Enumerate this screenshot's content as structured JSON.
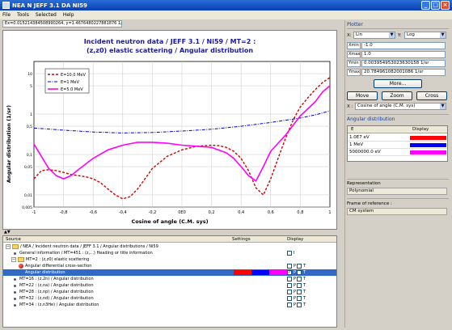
{
  "window": {
    "title": "NEA N JEFF 3.1 DA NI59",
    "controls": {
      "minimize": "_",
      "maximize": "□",
      "close": "×"
    }
  },
  "menu": [
    "File",
    "Tools",
    "Selected",
    "Help"
  ],
  "coord_readout": "Ex=0.015214384508990264, y=1.4676480227881876 1/sr)",
  "plot": {
    "title_line1": "Incident neutron data / JEFF 3.1 / Ni59 / MT=2 :",
    "title_line2": "(z,z0) elastic scattering / Angular distribution",
    "xlabel": "Cosine of angle (C.M. sys)",
    "ylabel": "Angular distribution (1/sr)"
  },
  "chart_data": {
    "type": "line",
    "xlim": [
      -1,
      1
    ],
    "ylim": [
      0.005,
      20
    ],
    "yscale": "log",
    "grid": true,
    "legend": "top-left",
    "x_ticks": [
      "-1",
      "-0,8",
      "-0,6",
      "-0,4",
      "-0,2",
      "0E0",
      "0,2",
      "0,4",
      "0,6",
      "0,8",
      "1"
    ],
    "y_ticks": [
      "0,005",
      "0,01",
      "0,05",
      "0,1",
      "0,5",
      "1",
      "5",
      "10"
    ],
    "series": [
      {
        "name": "E=10.0 MeV",
        "color": "#cc0000",
        "style": "dashed",
        "x": [
          -1.0,
          -0.95,
          -0.9,
          -0.85,
          -0.8,
          -0.75,
          -0.7,
          -0.65,
          -0.6,
          -0.55,
          -0.5,
          -0.45,
          -0.4,
          -0.35,
          -0.3,
          -0.25,
          -0.2,
          -0.1,
          0.0,
          0.1,
          0.2,
          0.25,
          0.3,
          0.35,
          0.4,
          0.45,
          0.5,
          0.55,
          0.6,
          0.65,
          0.7,
          0.75,
          0.8,
          0.85,
          0.9,
          0.95,
          1.0
        ],
        "y": [
          0.025,
          0.04,
          0.042,
          0.04,
          0.036,
          0.032,
          0.03,
          0.028,
          0.025,
          0.02,
          0.014,
          0.01,
          0.008,
          0.009,
          0.014,
          0.025,
          0.045,
          0.09,
          0.13,
          0.16,
          0.17,
          0.165,
          0.15,
          0.12,
          0.08,
          0.04,
          0.015,
          0.01,
          0.025,
          0.08,
          0.25,
          0.7,
          1.5,
          2.5,
          4.0,
          6.0,
          8.0
        ]
      },
      {
        "name": "E=1 MeV",
        "color": "#0000cc",
        "style": "dashdot",
        "x": [
          -1.0,
          -0.8,
          -0.6,
          -0.4,
          -0.2,
          0.0,
          0.2,
          0.4,
          0.6,
          0.8,
          0.9,
          1.0
        ],
        "y": [
          0.45,
          0.4,
          0.36,
          0.34,
          0.35,
          0.38,
          0.42,
          0.5,
          0.62,
          0.8,
          0.95,
          1.2
        ]
      },
      {
        "name": "E=5.0 MeV",
        "color": "#ff00ff",
        "style": "solid",
        "x": [
          -1.0,
          -0.95,
          -0.9,
          -0.85,
          -0.8,
          -0.75,
          -0.7,
          -0.65,
          -0.6,
          -0.5,
          -0.4,
          -0.3,
          -0.2,
          -0.1,
          0.0,
          0.1,
          0.2,
          0.3,
          0.35,
          0.4,
          0.45,
          0.5,
          0.55,
          0.6,
          0.7,
          0.8,
          0.9,
          0.95,
          1.0
        ],
        "y": [
          0.18,
          0.09,
          0.045,
          0.03,
          0.025,
          0.03,
          0.042,
          0.058,
          0.08,
          0.13,
          0.17,
          0.2,
          0.2,
          0.19,
          0.17,
          0.16,
          0.15,
          0.11,
          0.08,
          0.05,
          0.03,
          0.022,
          0.05,
          0.12,
          0.3,
          0.9,
          2.0,
          3.5,
          5.0
        ]
      }
    ]
  },
  "tree": {
    "headers": {
      "source": "Source",
      "settings": "Settings",
      "display": "Display"
    },
    "rows": [
      {
        "indent": 0,
        "icon": "folder",
        "label": "/ NEA / Incident neutron data / JEFF 3.1 / Angular distributions / Ni59",
        "checks": []
      },
      {
        "indent": 1,
        "icon": "bullet",
        "label": "General information / MT=451 : (z,...) Heading or title information",
        "checks": [
          "I"
        ]
      },
      {
        "indent": 1,
        "icon": "folder",
        "label": "MT=2 : (z,z0) elastic scattering",
        "checks": []
      },
      {
        "indent": 2,
        "icon": "redball",
        "label": "Angular differential cross-section",
        "checks": [
          "P",
          "T"
        ]
      },
      {
        "indent": 2,
        "icon": "none",
        "label": "Angular distribution",
        "checks": [
          "P",
          "T"
        ],
        "selected": true
      },
      {
        "indent": 1,
        "icon": "bullet",
        "label": "MT=16 : (z,2n) / Angular distribution",
        "checks": [
          "P",
          "T"
        ]
      },
      {
        "indent": 1,
        "icon": "bullet",
        "label": "MT=22 : (z,na) / Angular distribution",
        "checks": [
          "P",
          "T"
        ]
      },
      {
        "indent": 1,
        "icon": "bullet",
        "label": "MT=28 : (z,np) / Angular distribution",
        "checks": [
          "P",
          "T"
        ]
      },
      {
        "indent": 1,
        "icon": "bullet",
        "label": "MT=32 : (z,nd) / Angular distribution",
        "checks": [
          "P",
          "T"
        ]
      },
      {
        "indent": 1,
        "icon": "bullet",
        "label": "MT=34 : (z,n3He) / Angular distribution",
        "checks": [
          "P",
          "T"
        ]
      }
    ]
  },
  "plotter": {
    "section": "Plotter",
    "x_label": "X:",
    "x_scale": "Lin",
    "y_label": "Y:",
    "y_scale": "Log",
    "xmin_label": "Xmin",
    "xmin": "-1.0",
    "xmax_label": "Xmax",
    "xmax": "1.0",
    "ymin_label": "Ymin",
    "ymin": "0.003954953023630158 1/sr",
    "ymax_label": "Ymax",
    "ymax": "20.784961082001086 1/sr",
    "more": "More...",
    "move": "Move",
    "zoom": "Zoom",
    "cross": "Cross",
    "xaxis_label": "X :",
    "xaxis_value": "Cosine of angle (C.M. sys)"
  },
  "angular": {
    "section": "Angular distribution",
    "col_e": "E",
    "col_display": "Display",
    "rows": [
      {
        "e": "1.0E7 eV",
        "color": "#ff0000"
      },
      {
        "e": "1 MeV",
        "color": "#0000ff"
      },
      {
        "e": "5000000.0 eV",
        "color": "#ff00ff"
      }
    ]
  },
  "representation": {
    "label": "Representation",
    "value": "Polynomial"
  },
  "frame": {
    "label": "Frame of reference :",
    "value": "CM system"
  },
  "colors": {
    "title_blue": "#1a1aa0",
    "selection": "#316ac5"
  }
}
